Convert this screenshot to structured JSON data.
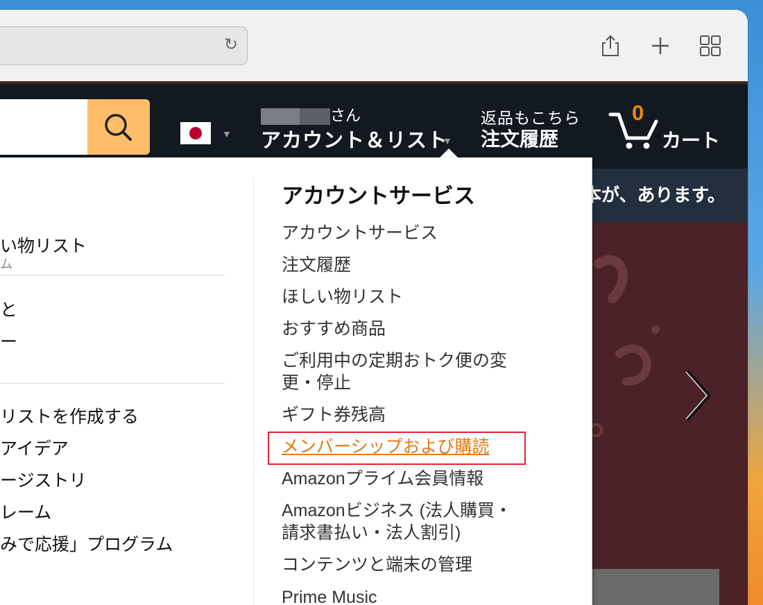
{
  "toolbar": {
    "reload_icon": "reload-icon",
    "share_icon": "share-icon",
    "new_tab_icon": "plus-icon",
    "tabs_icon": "tab-overview-icon"
  },
  "nav": {
    "search_icon": "search-icon",
    "account_hello_suffix": "さん",
    "account_main": "アカウント＆リスト",
    "orders_small": "返品もこちら",
    "orders_main": "注文履歴",
    "cart_count": "0",
    "cart_label": "カート",
    "colors": {
      "nav_bg": "#131921",
      "search_btn": "#febd69",
      "cart_count": "#f08804"
    }
  },
  "banner_text": "本が、あります。",
  "flyout": {
    "left": {
      "item1": "い物リスト",
      "item1_sub": "ム",
      "item2": "と",
      "item3": "ー",
      "item4": "リストを作成する",
      "item5": "アイデア",
      "item6": "ージストリ",
      "item7": "レーム",
      "item8": "みで応援」プログラム"
    },
    "right": {
      "heading": "アカウントサービス",
      "items": [
        "アカウントサービス",
        "注文履歴",
        "ほしい物リスト",
        "おすすめ商品",
        "ご利用中の定期おトク便の変",
        "更・停止",
        "ギフト券残高",
        "メンバーシップおよび購読",
        "Amazonプライム会員情報",
        "Amazonビジネス (法人購買・",
        "請求書払い・法人割引)",
        "コンテンツと端末の管理",
        "Prime Music"
      ],
      "highlight_color": "#e47911",
      "box_color": "#e0232b"
    }
  }
}
